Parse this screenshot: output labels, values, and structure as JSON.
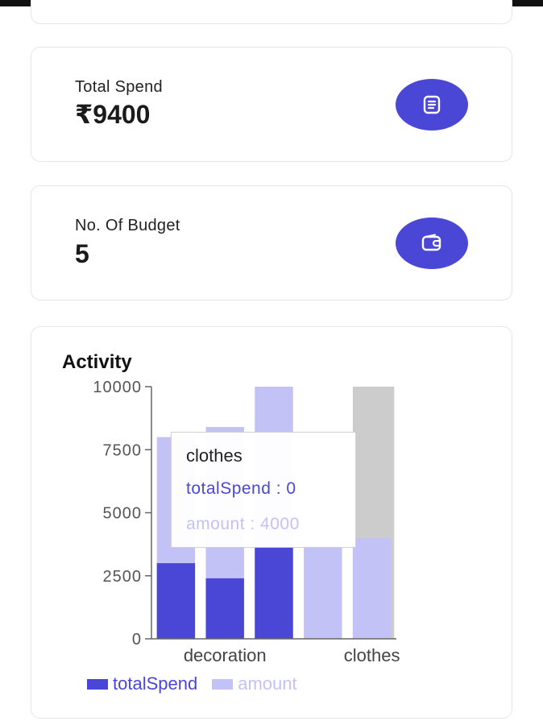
{
  "colors": {
    "accent": "#4b47d6",
    "light_series": "#c3c2f7",
    "hover_bg": "#cccccc",
    "card_border": "#e6e6e6"
  },
  "stats": {
    "total_spend": {
      "label": "Total Spend",
      "value": "₹9400",
      "icon": "receipt-icon"
    },
    "budgets": {
      "label": "No. Of Budget",
      "value": "5",
      "icon": "wallet-icon"
    }
  },
  "activity": {
    "title": "Activity"
  },
  "tooltip": {
    "title": "clothes",
    "row1": "totalSpend : 0",
    "row2": "amount : 4000"
  },
  "chart_data": {
    "type": "bar",
    "categories": [
      "",
      "decoration",
      "",
      "",
      "clothes"
    ],
    "ylim": [
      0,
      10000
    ],
    "yticks": [
      0,
      2500,
      5000,
      7500,
      10000
    ],
    "active_category_index": 4,
    "series": [
      {
        "name": "totalSpend",
        "color": "#4b47d6",
        "values": [
          3000,
          2400,
          3700,
          0,
          0
        ]
      },
      {
        "name": "amount",
        "color": "#c3c2f7",
        "values": [
          8000,
          8400,
          10000,
          3700,
          4000
        ]
      }
    ],
    "legend_position": "bottom-left"
  }
}
